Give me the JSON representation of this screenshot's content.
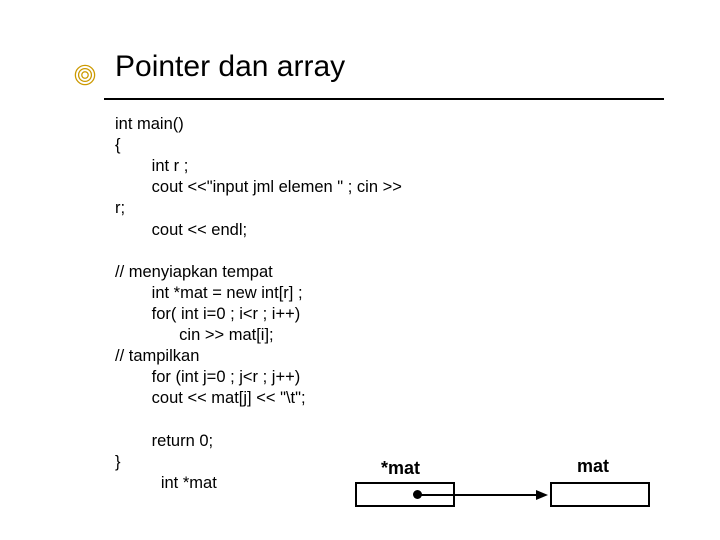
{
  "title": "Pointer dan array",
  "code": {
    "l1": "int main()",
    "l2": "{",
    "l3": "        int r ;",
    "l4": "        cout <<\"input jml elemen \" ; cin >>",
    "l5": "r;",
    "l6": "        cout << endl;",
    "blank1": "",
    "l7": "// menyiapkan tempat",
    "l8": "        int *mat = new int[r] ;",
    "l9": "        for( int i=0 ; i<r ; i++)",
    "l10": "              cin >> mat[i];",
    "l11": "// tampilkan",
    "l12": "        for (int j=0 ; j<r ; j++)",
    "l13": "        cout << mat[j] << \"\\t\";",
    "blank2": "",
    "l14": "        return 0;",
    "l15": "}",
    "l16": "          int *mat"
  },
  "diagram": {
    "label_deref": "*mat",
    "label_mat": "mat"
  },
  "icons": {
    "bullet": "spiral-bullet-icon",
    "arrow": "arrow-right-icon"
  },
  "colors": {
    "spiral": "#cc9900",
    "rule": "#000000"
  }
}
